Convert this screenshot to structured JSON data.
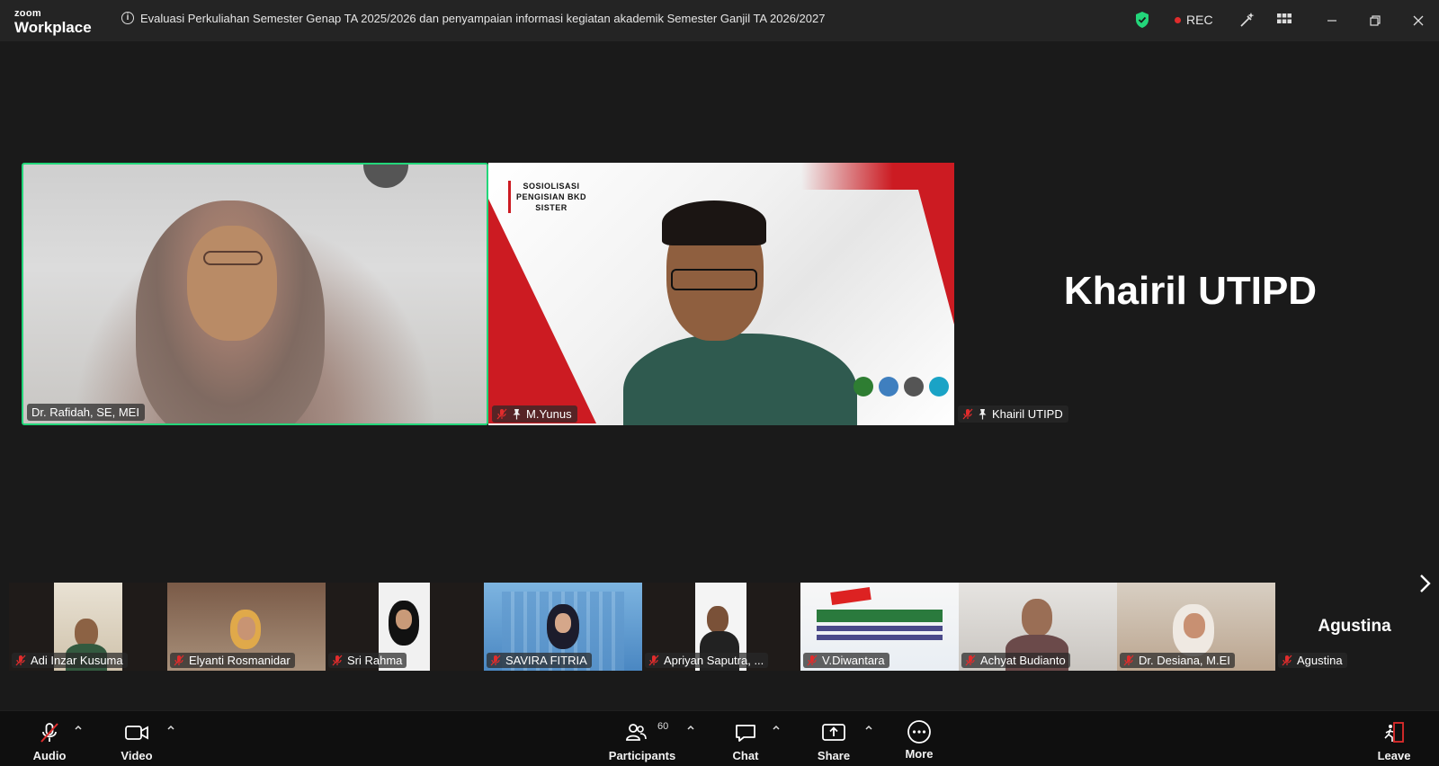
{
  "app": {
    "brand_small": "zoom",
    "brand_big": "Workplace",
    "meeting_title": "Evaluasi Perkuliahan Semester Genap TA 2025/2026 dan penyampaian informasi kegiatan akademik Semester Ganjil TA 2026/2027",
    "rec_label": "REC"
  },
  "speakers": [
    {
      "name": "Dr. Rafidah, SE, MEI",
      "muted": false,
      "pinned": false,
      "active": true
    },
    {
      "name": "M.Yunus",
      "muted": true,
      "pinned": true,
      "slide_title": "SOSIOLISASI\nPENGISIAN BKD\nSISTER"
    },
    {
      "name": "Khairil UTIPD",
      "muted": true,
      "pinned": true,
      "video_off": true
    }
  ],
  "gallery": [
    {
      "name": "Adi Inzar Kusuma"
    },
    {
      "name": "Elyanti Rosmanidar"
    },
    {
      "name": "Sri Rahma"
    },
    {
      "name": "SAVIRA FITRIA"
    },
    {
      "name": "Apriyan Saputra, ..."
    },
    {
      "name": "V.Diwantara"
    },
    {
      "name": "Achyat Budianto"
    },
    {
      "name": "Dr. Desiana, M.EI"
    },
    {
      "name": "Agustina",
      "video_off": true
    }
  ],
  "toolbar": {
    "audio": "Audio",
    "video": "Video",
    "participants": "Participants",
    "participants_count": "60",
    "chat": "Chat",
    "share": "Share",
    "more": "More",
    "leave": "Leave"
  },
  "colors": {
    "active_speaker_border": "#23d67a",
    "rec_dot": "#e02c2c",
    "shield": "#23d67a",
    "leave": "#e02c2c",
    "slide_red": "#cc1b22"
  },
  "icons": [
    "info-icon",
    "shield-icon",
    "annotate-icon",
    "apps-grid-icon",
    "minimize-icon",
    "restore-icon",
    "close-icon",
    "mic-muted-icon",
    "video-camera-icon",
    "participants-icon",
    "chat-icon",
    "share-screen-icon",
    "more-icon",
    "leave-icon",
    "pin-icon",
    "chevron-right-icon"
  ]
}
